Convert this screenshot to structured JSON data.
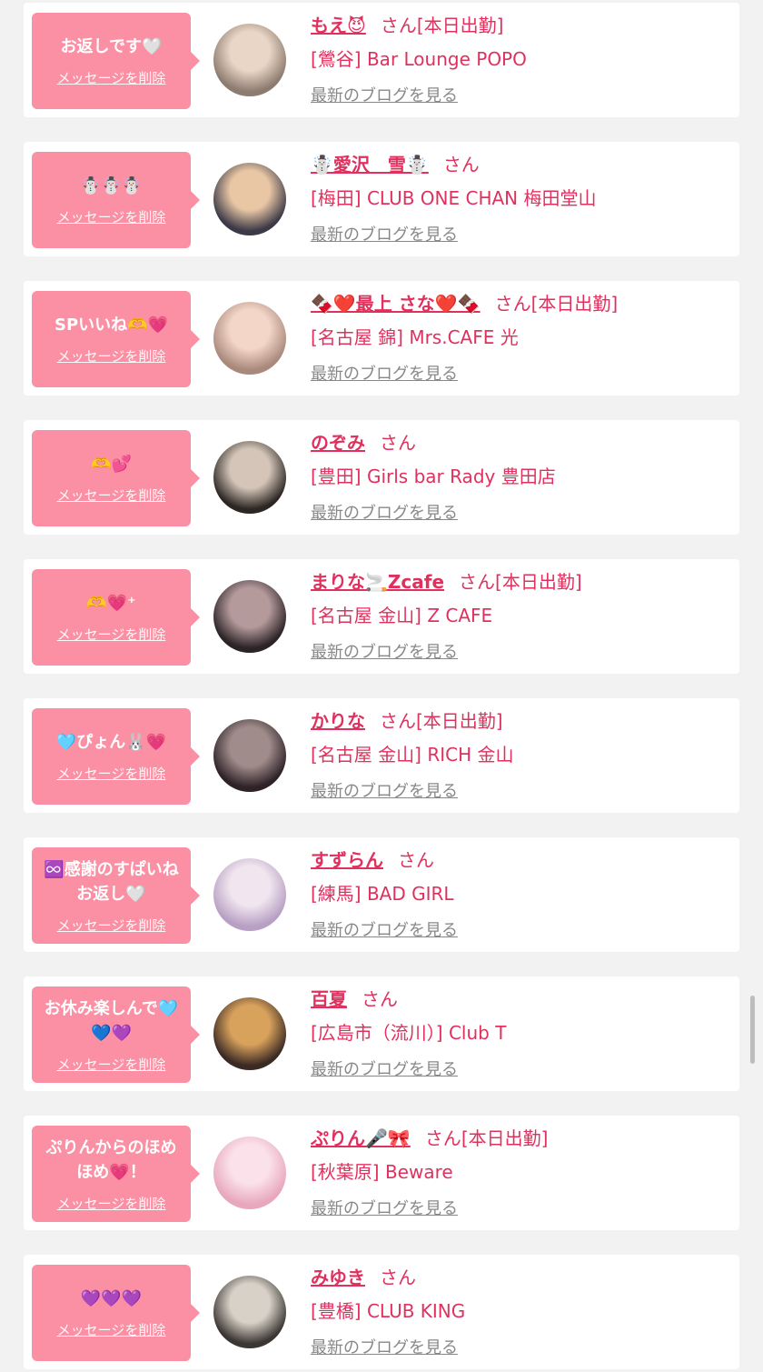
{
  "messages": [
    {
      "text": "お返しです🤍",
      "name": "もえ😈",
      "shop": "[鶯谷] Bar Lounge POPO",
      "today": "[本日出勤]",
      "colors": [
        "#e9d6c6",
        "#8c7b6f"
      ]
    },
    {
      "text": "☃️☃️☃️",
      "name": "☃️愛沢＿雪☃️",
      "shop": "[梅田] CLUB ONE CHAN 梅田堂山",
      "today": "",
      "colors": [
        "#e9c7a5",
        "#3d3a48"
      ]
    },
    {
      "text": "SPいいね🫶💗",
      "name": "🍫❤️最上 さな❤️🍫",
      "shop": "[名古屋 錦] Mrs.CAFE 光",
      "today": "[本日出勤]",
      "colors": [
        "#f3d6c8",
        "#a9897c"
      ]
    },
    {
      "text": "🫶💕",
      "name": "のぞみ",
      "shop": "[豊田] Girls bar Rady 豊田店",
      "today": "",
      "colors": [
        "#d4c5b8",
        "#2d2724"
      ]
    },
    {
      "text": "🫶💗⁺",
      "name": "まりな🚬Zcafe",
      "shop": "[名古屋 金山] Z CAFE",
      "today": "[本日出勤]",
      "colors": [
        "#b59a9c",
        "#2b2326"
      ]
    },
    {
      "text": "🩵ぴょん🐰💗",
      "name": "かりな",
      "shop": "[名古屋 金山] RICH 金山",
      "today": "[本日出勤]",
      "colors": [
        "#a08c8a",
        "#2e2228"
      ]
    },
    {
      "text": "♾️感謝のすぱいね\nお返し🤍",
      "name": "すずらん",
      "shop": "[練馬] BAD GIRL",
      "today": "",
      "colors": [
        "#f1e6ef",
        "#b8a0c4"
      ]
    },
    {
      "text": "お休み楽しんで🩵\n💙💜",
      "name": "百夏",
      "shop": "[広島市（流川）] Club T",
      "today": "",
      "colors": [
        "#d9a25c",
        "#3b2a24"
      ]
    },
    {
      "text": "ぷりんからのほめ\nほめ💗！",
      "name": "ぷりん🎤🎀",
      "shop": "[秋葉原] Beware",
      "today": "[本日出勤]",
      "colors": [
        "#fbe1e9",
        "#e7a7bd"
      ]
    },
    {
      "text": "💜💜💜",
      "name": "みゆき",
      "shop": "[豊橋] CLUB KING",
      "today": "",
      "colors": [
        "#d7d1c8",
        "#3b3633"
      ]
    }
  ],
  "labels": {
    "delete": "メッセージを削除",
    "san": "さん",
    "blog": "最新のブログを見る"
  }
}
